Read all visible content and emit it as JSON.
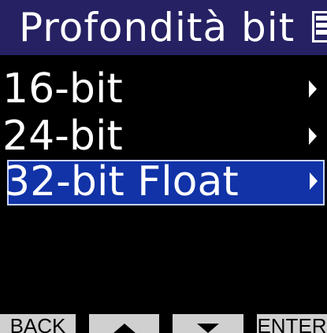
{
  "title": "Profondità bit",
  "battery_icon": "battery-icon",
  "menu": {
    "items": [
      {
        "label": "16-bit",
        "selected": false
      },
      {
        "label": "24-bit",
        "selected": false
      },
      {
        "label": "32-bit Float",
        "selected": true
      }
    ],
    "chevron_icon": "chevron-right-icon"
  },
  "softkeys": {
    "back": "BACK",
    "up_icon": "up-arrow-icon",
    "down_icon": "down-arrow-icon",
    "enter": "ENTER"
  },
  "colors": {
    "title_bar": "#262163",
    "selection": "#1133a7",
    "softkey_bg": "#d0d0d0"
  }
}
